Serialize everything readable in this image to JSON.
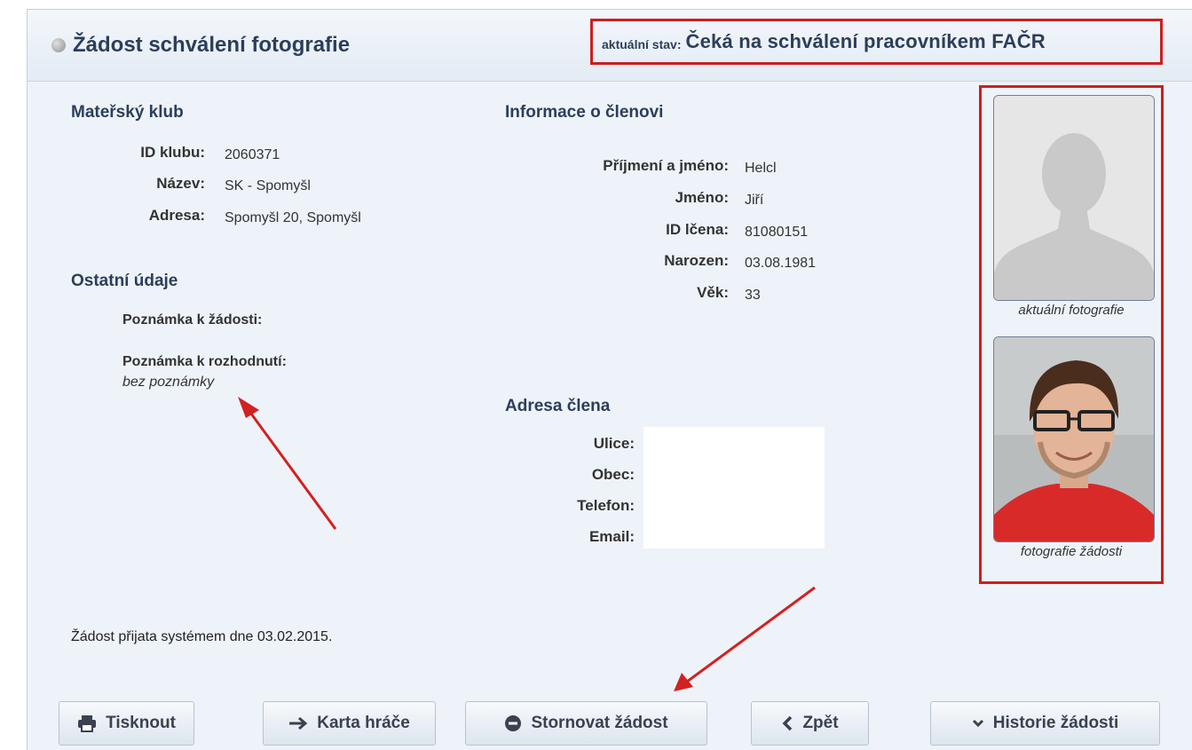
{
  "header": {
    "title": "Žádost schválení fotografie",
    "state_label": "aktuální stav:",
    "state_value": "Čeká na schválení pracovníkem FAČR"
  },
  "club": {
    "heading": "Mateřský klub",
    "fields": [
      {
        "label": "ID klubu:",
        "value": "2060371"
      },
      {
        "label": "Název:",
        "value": "SK - Spomyšl"
      },
      {
        "label": "Adresa:",
        "value": "Spomyšl 20, Spomyšl"
      }
    ]
  },
  "other": {
    "heading": "Ostatní údaje",
    "request_note_label": "Poznámka k žádosti:",
    "decision_note_label": "Poznámka k rozhodnutí:",
    "decision_note_value": "bez poznámky"
  },
  "member": {
    "heading": "Informace o členovi",
    "fields": [
      {
        "label": "Příjmení a jméno:",
        "value": "Helcl"
      },
      {
        "label": "Jméno:",
        "value": "Jiří"
      },
      {
        "label": "ID lčena:",
        "value": "81080151"
      },
      {
        "label": "Narozen:",
        "value": "03.08.1981"
      },
      {
        "label": "Věk:",
        "value": "33"
      }
    ]
  },
  "address": {
    "heading": "Adresa člena",
    "fields": [
      {
        "label": "Ulice:"
      },
      {
        "label": "Obec:"
      },
      {
        "label": "Telefon:"
      },
      {
        "label": "Email:"
      }
    ]
  },
  "photos": {
    "current_caption": "aktuální fotografie",
    "request_caption": "fotografie žádosti"
  },
  "received_text": "Žádost přijata systémem dne 03.02.2015.",
  "buttons": {
    "print": "Tisknout",
    "player_card": "Karta hráče",
    "cancel": "Stornovat žádost",
    "back": "Zpět",
    "history": "Historie žádosti"
  },
  "colors": {
    "highlight_red": "#cc1f1f",
    "heading_blue": "#2c3e5a",
    "panel_bg": "#eef3f9"
  }
}
